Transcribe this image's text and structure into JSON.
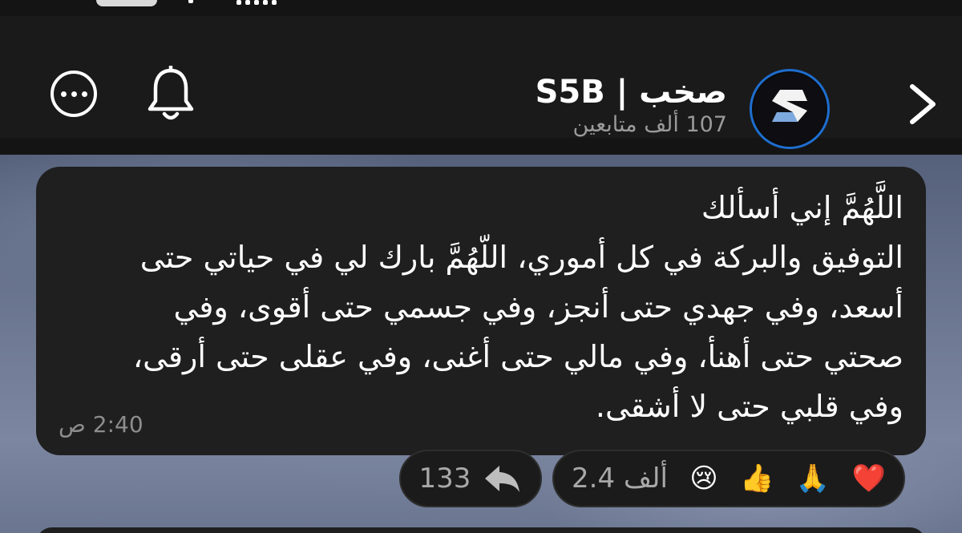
{
  "header": {
    "channel_name": "صخب | S5B",
    "followers": "107 ألف متابعين",
    "icons": {
      "more": "more-options-icon",
      "bell": "bell-icon",
      "back": "chevron-right-icon",
      "avatar": "channel-logo"
    },
    "accent_color": "#1e6ecf"
  },
  "message": {
    "lines": [
      "اللَّهُمَّ إني أسألك",
      "التوفيق والبركة في كل أموري، اللّهُمَّ بارك لي في حياتي حتى",
      "أسعد، وفي جهدي حتى أنجز، وفي جسمي حتى أقوى، وفي",
      "صحتي حتى أهنأ، وفي مالي حتى أغنى، وفي عقلى حتى أرقى،",
      "وفي قلبي حتى لا أشقى."
    ],
    "time": "2:40 ص"
  },
  "reactions": {
    "emojis": [
      "❤️",
      "🙏",
      "👍",
      "😢"
    ],
    "count": "2.4 ألف",
    "shares": "133",
    "share_icon": "share-arrow-icon"
  }
}
